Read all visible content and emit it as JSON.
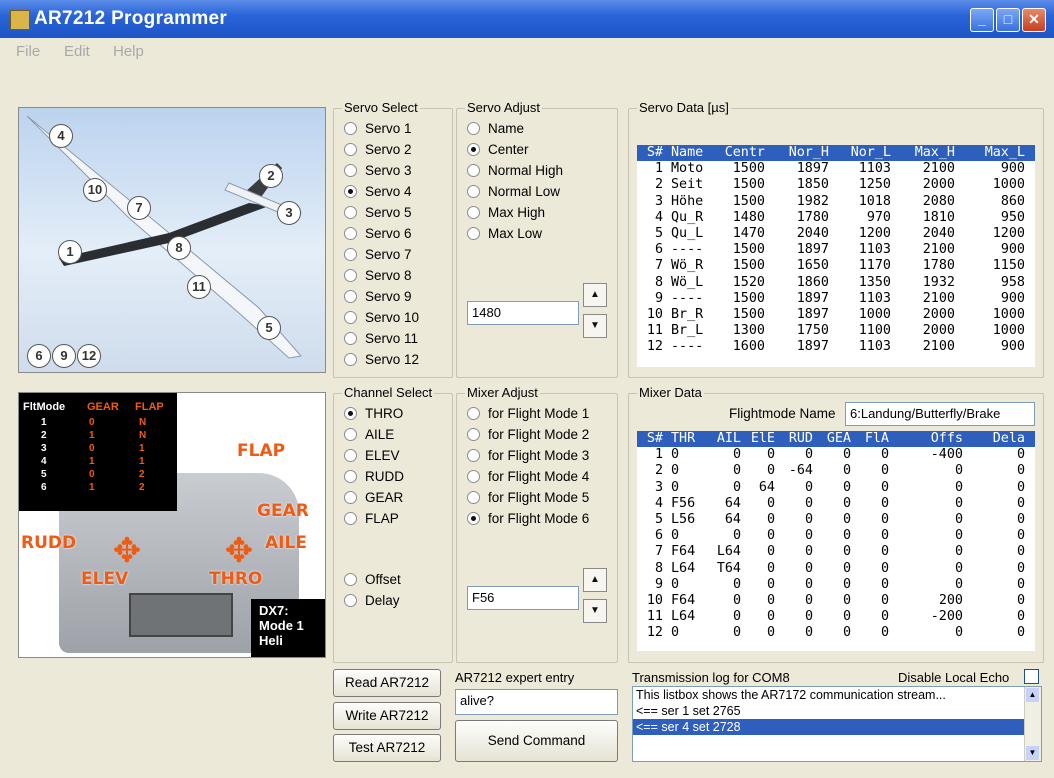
{
  "window": {
    "title": "AR7212 Programmer"
  },
  "menu": [
    "File",
    "Edit",
    "Help"
  ],
  "plane_badges": [
    "4",
    "2",
    "3",
    "10",
    "7",
    "1",
    "8",
    "11",
    "5"
  ],
  "plane_bottom_badges": [
    "6",
    "9",
    "12"
  ],
  "transmitter": {
    "table_header": [
      "FltMode",
      "GEAR",
      "FLAP"
    ],
    "rows": [
      [
        "1",
        "0",
        "N"
      ],
      [
        "2",
        "1",
        "N"
      ],
      [
        "3",
        "0",
        "1"
      ],
      [
        "4",
        "1",
        "1"
      ],
      [
        "5",
        "0",
        "2"
      ],
      [
        "6",
        "1",
        "2"
      ]
    ],
    "labels": {
      "flap": "FLAP",
      "gear": "GEAR",
      "rudd": "RUDD",
      "aile": "AILE",
      "elev": "ELEV",
      "thro": "THRO"
    },
    "caption": [
      "DX7:",
      "Mode 1",
      "Heli"
    ]
  },
  "servo_select": {
    "title": "Servo Select",
    "options": [
      "Servo 1",
      "Servo 2",
      "Servo 3",
      "Servo 4",
      "Servo 5",
      "Servo 6",
      "Servo 7",
      "Servo 8",
      "Servo 9",
      "Servo 10",
      "Servo 11",
      "Servo 12"
    ],
    "selected": 3
  },
  "servo_adjust": {
    "title": "Servo Adjust",
    "options": [
      "Name",
      "Center",
      "Normal High",
      "Normal Low",
      "Max High",
      "Max Low"
    ],
    "selected": 1,
    "value": "1480"
  },
  "channel_select": {
    "title": "Channel Select",
    "options": [
      "THRO",
      "AILE",
      "ELEV",
      "RUDD",
      "GEAR",
      "FLAP"
    ],
    "selected": 0,
    "extra_options": [
      "Offset",
      "Delay"
    ]
  },
  "mixer_adjust": {
    "title": "Mixer Adjust",
    "options": [
      "for Flight Mode 1",
      "for Flight Mode 2",
      "for Flight Mode 3",
      "for Flight Mode 4",
      "for Flight Mode 5",
      "for Flight Mode 6"
    ],
    "selected": 5,
    "value": "F56"
  },
  "servo_data": {
    "title": "Servo Data [µs]",
    "columns": [
      "S#",
      "Name",
      "Centr",
      "Nor_H",
      "Nor_L",
      "Max_H",
      "Max_L"
    ],
    "rows": [
      [
        "1",
        "Moto",
        "1500",
        "1897",
        "1103",
        "2100",
        "900"
      ],
      [
        "2",
        "Seit",
        "1500",
        "1850",
        "1250",
        "2000",
        "1000"
      ],
      [
        "3",
        "Höhe",
        "1500",
        "1982",
        "1018",
        "2080",
        "860"
      ],
      [
        "4",
        "Qu_R",
        "1480",
        "1780",
        "970",
        "1810",
        "950"
      ],
      [
        "5",
        "Qu_L",
        "1470",
        "2040",
        "1200",
        "2040",
        "1200"
      ],
      [
        "6",
        "----",
        "1500",
        "1897",
        "1103",
        "2100",
        "900"
      ],
      [
        "7",
        "Wö_R",
        "1500",
        "1650",
        "1170",
        "1780",
        "1150"
      ],
      [
        "8",
        "Wö_L",
        "1520",
        "1860",
        "1350",
        "1932",
        "958"
      ],
      [
        "9",
        "----",
        "1500",
        "1897",
        "1103",
        "2100",
        "900"
      ],
      [
        "10",
        "Br_R",
        "1500",
        "1897",
        "1000",
        "2000",
        "1000"
      ],
      [
        "11",
        "Br_L",
        "1300",
        "1750",
        "1100",
        "2000",
        "1000"
      ],
      [
        "12",
        "----",
        "1600",
        "1897",
        "1103",
        "2100",
        "900"
      ]
    ]
  },
  "mixer_data": {
    "title": "Mixer Data",
    "flightmode_label": "Flightmode Name",
    "flightmode_value": "6:Landung/Butterfly/Brake",
    "columns": [
      "S#",
      "THR",
      "AIL",
      "ElE",
      "RUD",
      "GEA",
      "FlA",
      "Offs",
      "Dela"
    ],
    "rows": [
      [
        "1",
        "0",
        "0",
        "0",
        "0",
        "0",
        "0",
        "-400",
        "0"
      ],
      [
        "2",
        "0",
        "0",
        "0",
        "-64",
        "0",
        "0",
        "0",
        "0"
      ],
      [
        "3",
        "0",
        "0",
        "64",
        "0",
        "0",
        "0",
        "0",
        "0"
      ],
      [
        "4",
        "F56",
        "64",
        "0",
        "0",
        "0",
        "0",
        "0",
        "0"
      ],
      [
        "5",
        "L56",
        "64",
        "0",
        "0",
        "0",
        "0",
        "0",
        "0"
      ],
      [
        "6",
        "0",
        "0",
        "0",
        "0",
        "0",
        "0",
        "0",
        "0"
      ],
      [
        "7",
        "F64",
        "L64",
        "0",
        "0",
        "0",
        "0",
        "0",
        "0"
      ],
      [
        "8",
        "L64",
        "T64",
        "0",
        "0",
        "0",
        "0",
        "0",
        "0"
      ],
      [
        "9",
        "0",
        "0",
        "0",
        "0",
        "0",
        "0",
        "0",
        "0"
      ],
      [
        "10",
        "F64",
        "0",
        "0",
        "0",
        "0",
        "0",
        "200",
        "0"
      ],
      [
        "11",
        "L64",
        "0",
        "0",
        "0",
        "0",
        "0",
        "-200",
        "0"
      ],
      [
        "12",
        "0",
        "0",
        "0",
        "0",
        "0",
        "0",
        "0",
        "0"
      ]
    ]
  },
  "buttons": {
    "read": "Read AR7212",
    "write": "Write AR7212",
    "test": "Test AR7212",
    "send": "Send Command"
  },
  "expert": {
    "label": "AR7212 expert entry",
    "value": "alive?"
  },
  "log": {
    "label": "Transmission log for COM8",
    "echo_label": "Disable Local Echo",
    "lines": [
      "This listbox shows the AR7172 communication stream...",
      "<== ser  1 set  2765",
      "<== ser  4 set  2728"
    ],
    "selected": 2
  }
}
